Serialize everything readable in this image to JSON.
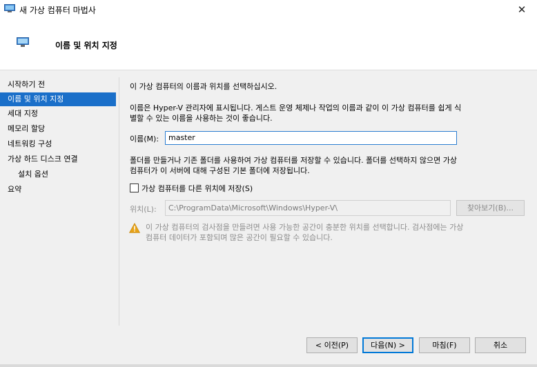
{
  "window": {
    "title": "새 가상 컴퓨터 마법사",
    "close_glyph": "✕"
  },
  "header": {
    "title": "이름 및 위치 지정"
  },
  "sidebar": {
    "items": [
      {
        "label": "시작하기 전"
      },
      {
        "label": "이름 및 위치 지정"
      },
      {
        "label": "세대 지정"
      },
      {
        "label": "메모리 할당"
      },
      {
        "label": "네트워킹 구성"
      },
      {
        "label": "가상 하드 디스크 연결"
      },
      {
        "label": "설치 옵션"
      },
      {
        "label": "요약"
      }
    ]
  },
  "main": {
    "intro": "이 가상 컴퓨터의 이름과 위치를 선택하십시오.",
    "desc_line1": "이름은 Hyper-V 관리자에 표시됩니다. 게스트 운영 체제나 작업의 이름과 같이 이 가상 컴퓨터를 쉽게 식",
    "desc_line2": "별할 수 있는 이름을 사용하는 것이 좋습니다.",
    "name_label": "이름(M):",
    "name_value": "master",
    "folder_line1": "폴더를 만들거나 기존 폴더를 사용하여 가상 컴퓨터를 저장할 수 있습니다. 폴더를 선택하지 않으면 가상",
    "folder_line2": "컴퓨터가 이 서버에 대해 구성된 기본 폴더에 저장됩니다.",
    "checkbox_label": "가상 컴퓨터를 다른 위치에 저장(S)",
    "checkbox_checked": false,
    "location_label": "위치(L):",
    "location_value": "C:\\ProgramData\\Microsoft\\Windows\\Hyper-V\\",
    "browse_label": "찾아보기(B)...",
    "warning_line1": "이 가상 컴퓨터의 검사점을 만들려면 사용 가능한 공간이 충분한 위치를 선택합니다. 검사점에는 가상",
    "warning_line2": "컴퓨터 데이터가 포함되며 많은 공간이 필요할 수 있습니다."
  },
  "buttons": {
    "prev": "< 이전(P)",
    "next": "다음(N) >",
    "finish": "마침(F)",
    "cancel": "취소"
  },
  "colors": {
    "selection": "#1a6fc9",
    "warning": "#e8a317"
  },
  "icons": {
    "app": "vm-monitor-icon",
    "header": "vm-monitor-icon",
    "warning": "warning-triangle-icon"
  }
}
